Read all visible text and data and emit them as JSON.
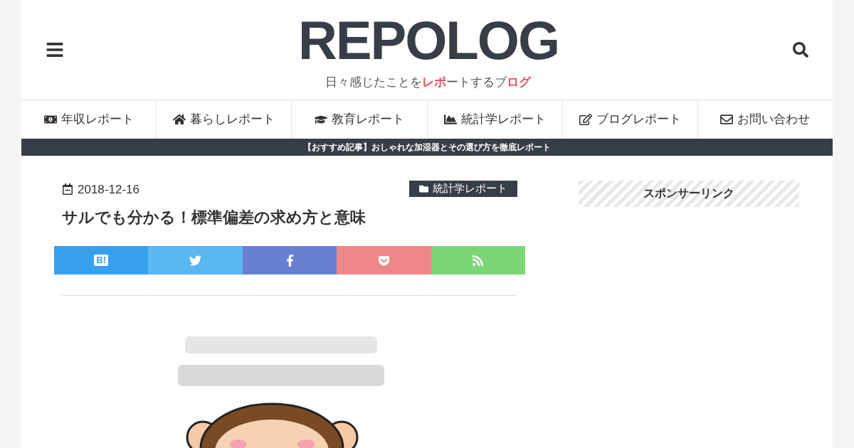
{
  "header": {
    "logo": "REPOLOG",
    "tagline": [
      {
        "text": "日々感じたことを",
        "accent": false
      },
      {
        "text": "レポ",
        "accent": true
      },
      {
        "text": "ートするブ",
        "accent": false
      },
      {
        "text": "ログ",
        "accent": true
      }
    ]
  },
  "nav": [
    {
      "label": "年収レポート",
      "kind": "money"
    },
    {
      "label": "暮らしレポート",
      "kind": "home"
    },
    {
      "label": "教育レポート",
      "kind": "education"
    },
    {
      "label": "統計学レポート",
      "kind": "chart"
    },
    {
      "label": "ブログレポート",
      "kind": "edit"
    },
    {
      "label": "お問い合わせ",
      "kind": "mail"
    }
  ],
  "notice": "【おすすめ記事】おしゃれな加湿器とその選び方を徹底レポート",
  "article": {
    "date": "2018-12-16",
    "category": "統計学レポート",
    "title": "サルでも分かる！標準偏差の求め方と意味",
    "share": [
      {
        "kind": "hatena",
        "label": "B!",
        "color": "#35a0ee"
      },
      {
        "kind": "twitter",
        "color": "#5bb7ef"
      },
      {
        "kind": "facebook",
        "color": "#6880d4"
      },
      {
        "kind": "pocket",
        "color": "#ee8789"
      },
      {
        "kind": "feed",
        "color": "#7cd675"
      }
    ]
  },
  "sidebar": {
    "heading": "スポンサーリンク"
  }
}
